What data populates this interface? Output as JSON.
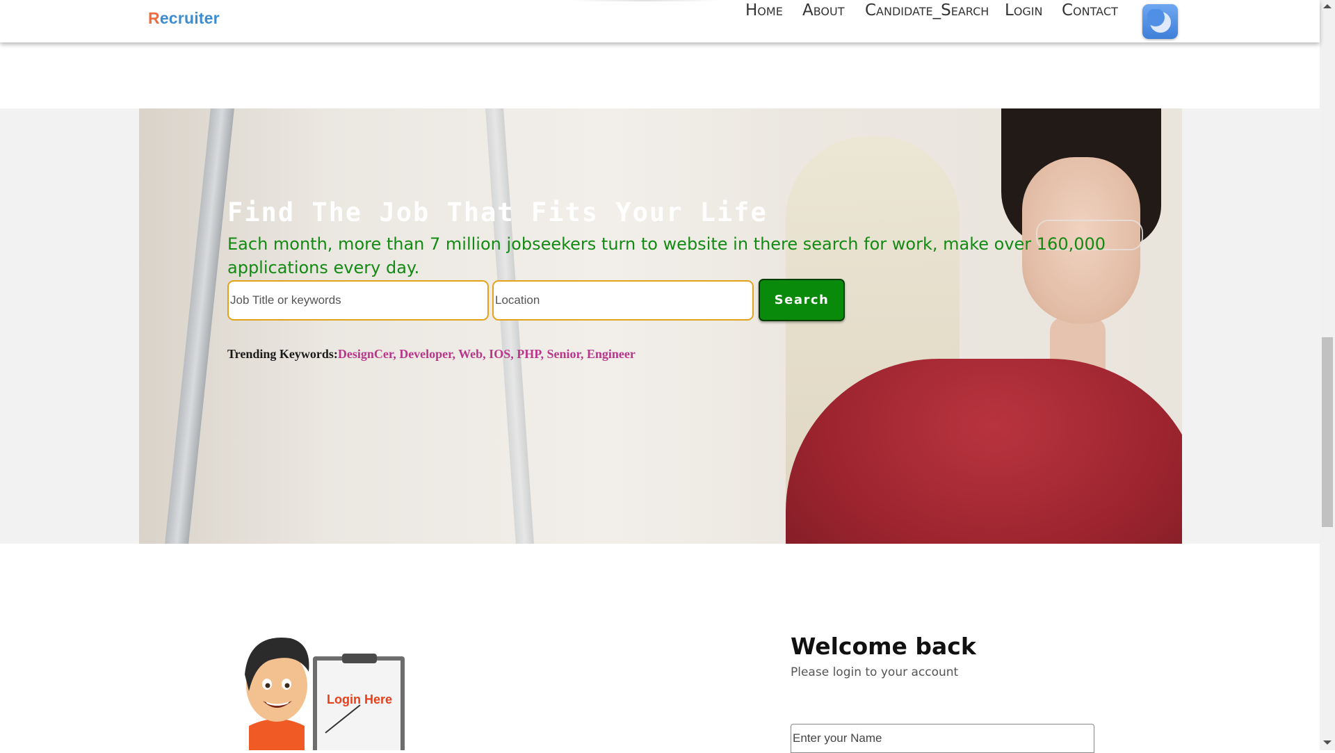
{
  "header": {
    "logo_first": "R",
    "logo_rest": "ecruiter",
    "nav": [
      {
        "label": "Home"
      },
      {
        "label": "About"
      },
      {
        "label": "Candidate_Search"
      },
      {
        "label": "Login"
      },
      {
        "label": "Contact"
      }
    ],
    "theme_toggle_icon": "moon-icon"
  },
  "hero": {
    "title": "Find The Job That Fits Your Life",
    "subtitle": "Each month, more than 7 million jobseekers turn to website in there search for work, make over 160,000 applications every day.",
    "job_placeholder": "Job Title or keywords",
    "location_placeholder": "Location",
    "search_label": "Search",
    "trending_label": "Trending Keywords:",
    "trending_keywords": "DesignCer, Developer, Web, IOS, PHP, Senior, Engineer"
  },
  "login": {
    "illustration_caption": "Login Here",
    "title": "Welcome back",
    "subtitle": "Please login to your account",
    "name_placeholder": "Enter your Name"
  },
  "colors": {
    "subtitle_green": "#138a13",
    "search_button": "#0a8a0a",
    "input_border": "#e3a21a",
    "keywords_pink": "#b9368b",
    "logo_orange": "#ef6b3e",
    "logo_blue": "#3d8ccf"
  }
}
